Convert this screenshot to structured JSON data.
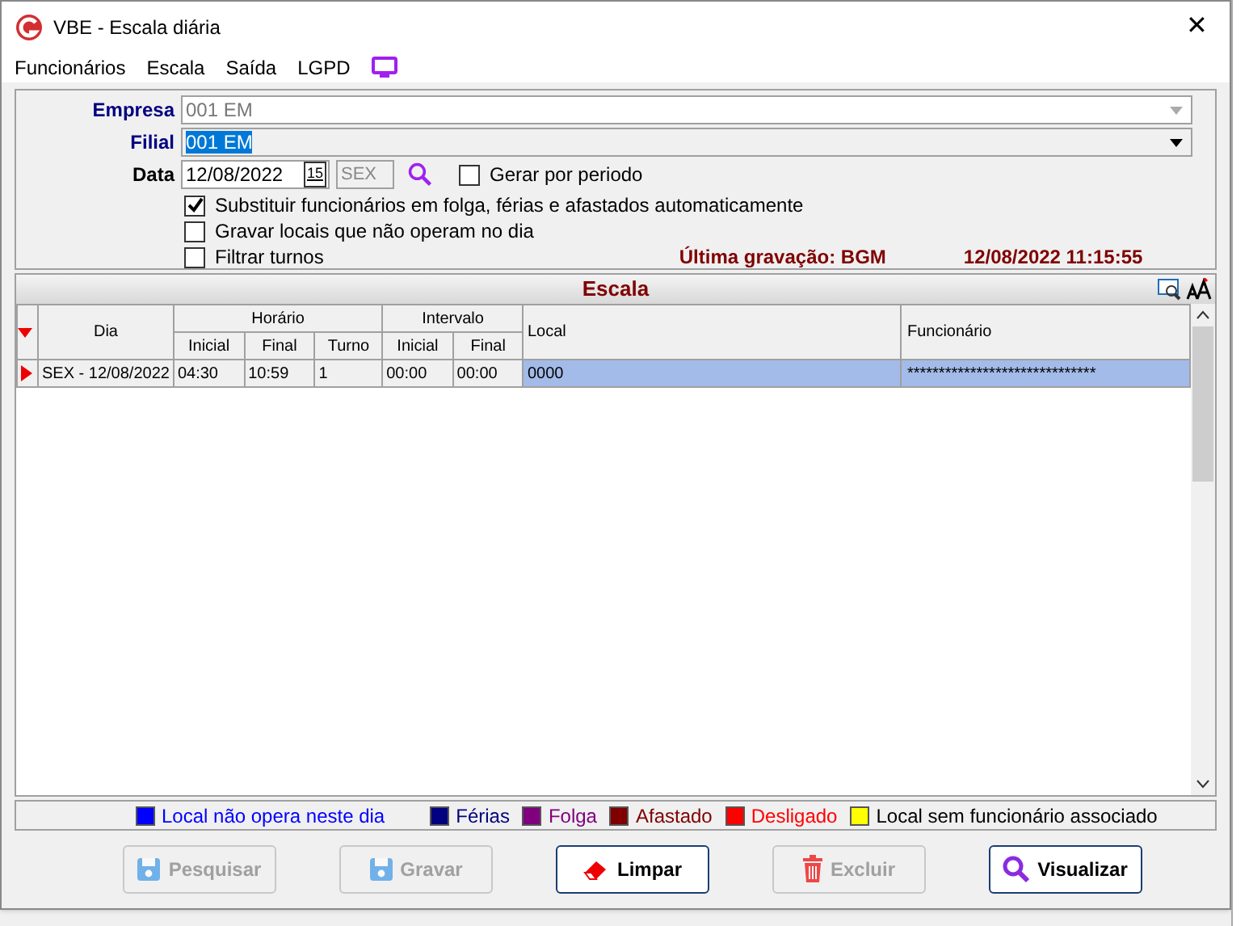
{
  "window": {
    "title": "VBE - Escala diária",
    "close": "✕"
  },
  "menu": [
    {
      "label": "Funcionários"
    },
    {
      "label": "Escala"
    },
    {
      "label": "Saída"
    },
    {
      "label": "LGPD"
    }
  ],
  "form": {
    "empresa": {
      "label": "Empresa",
      "value": "001 EM",
      "disabled": true
    },
    "filial": {
      "label": "Filial",
      "value": "001 EM",
      "disabled": false
    },
    "data": {
      "label": "Data",
      "value": "12/08/2022",
      "calendar": "15",
      "weekday": "SEX"
    },
    "checkboxes": [
      {
        "label": "Gerar por periodo",
        "checked": false
      },
      {
        "label": "Substituir funcionários em folga, férias e afastados automaticamente",
        "checked": true
      },
      {
        "label": "Gravar locais que não operam no dia",
        "checked": false
      },
      {
        "label": "Filtrar turnos",
        "checked": false
      }
    ],
    "last_save": "Última gravação: BGM",
    "last_save_time": "12/08/2022 11:15:55"
  },
  "grid": {
    "title": "Escala",
    "headers": {
      "dia": "Dia",
      "horario": "Horário",
      "intervalo": "Intervalo",
      "inicial": "Inicial",
      "final": "Final",
      "turno": "Turno",
      "inicial2": "Inicial",
      "final2": "Final",
      "local": "Local",
      "funcionario": "Funcionário"
    },
    "rows": [
      {
        "dia": "SEX - 12/08/2022",
        "inicial": "04:30",
        "final": "10:59",
        "turno": "1",
        "inicial2": "00:00",
        "final2": "00:00",
        "local": "0000",
        "funcionario": "******************************",
        "selected": true
      }
    ]
  },
  "legend": [
    {
      "label": "Local não opera neste dia",
      "color": "#0000ff"
    },
    {
      "label": "Férias",
      "color": "#000080"
    },
    {
      "label": "Folga",
      "color": "#800080"
    },
    {
      "label": "Afastado",
      "color": "#800000"
    },
    {
      "label": "Desligado",
      "color": "#ff0000"
    },
    {
      "label": "Local sem funcionário associado",
      "color": "#ffff00"
    }
  ],
  "buttons": [
    {
      "label": "Pesquisar",
      "kind": "save",
      "disabled": true
    },
    {
      "label": "Gravar",
      "kind": "save",
      "disabled": true
    },
    {
      "label": "Limpar",
      "kind": "eraser",
      "disabled": false
    },
    {
      "label": "Excluir",
      "kind": "trash",
      "disabled": true
    },
    {
      "label": "Visualizar",
      "kind": "search",
      "disabled": false
    }
  ]
}
